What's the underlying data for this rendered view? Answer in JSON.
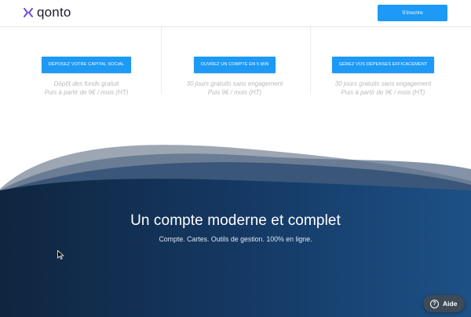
{
  "header": {
    "brand": "qonto",
    "cta_label": "S'inscrire"
  },
  "features": [
    {
      "button": "Déposez votre capital social",
      "line1": "Dépôt des fonds gratuit",
      "line2": "Puis à partir de 9€ / mois (HT)"
    },
    {
      "button": "Ouvrez un compte en 5 min",
      "line1": "30 jours gratuits sans engagement",
      "line2": "Puis 9€ / mois (HT)"
    },
    {
      "button": "Gérez vos dépenses efficacement",
      "line1": "30 jours gratuits sans engagement",
      "line2": "Puis à partir de 9€ / mois (HT)"
    }
  ],
  "hero": {
    "title": "Un compte moderne et complet",
    "subtitle": "Compte. Cartes. Outils de gestion. 100% en ligne."
  },
  "help": {
    "label": "Aide",
    "icon": "question-icon"
  },
  "colors": {
    "accent": "#1c9af5",
    "hero_dark": "#0f2a47",
    "hero_light": "#1d5186",
    "brand_mark": "#6b4fd8"
  }
}
